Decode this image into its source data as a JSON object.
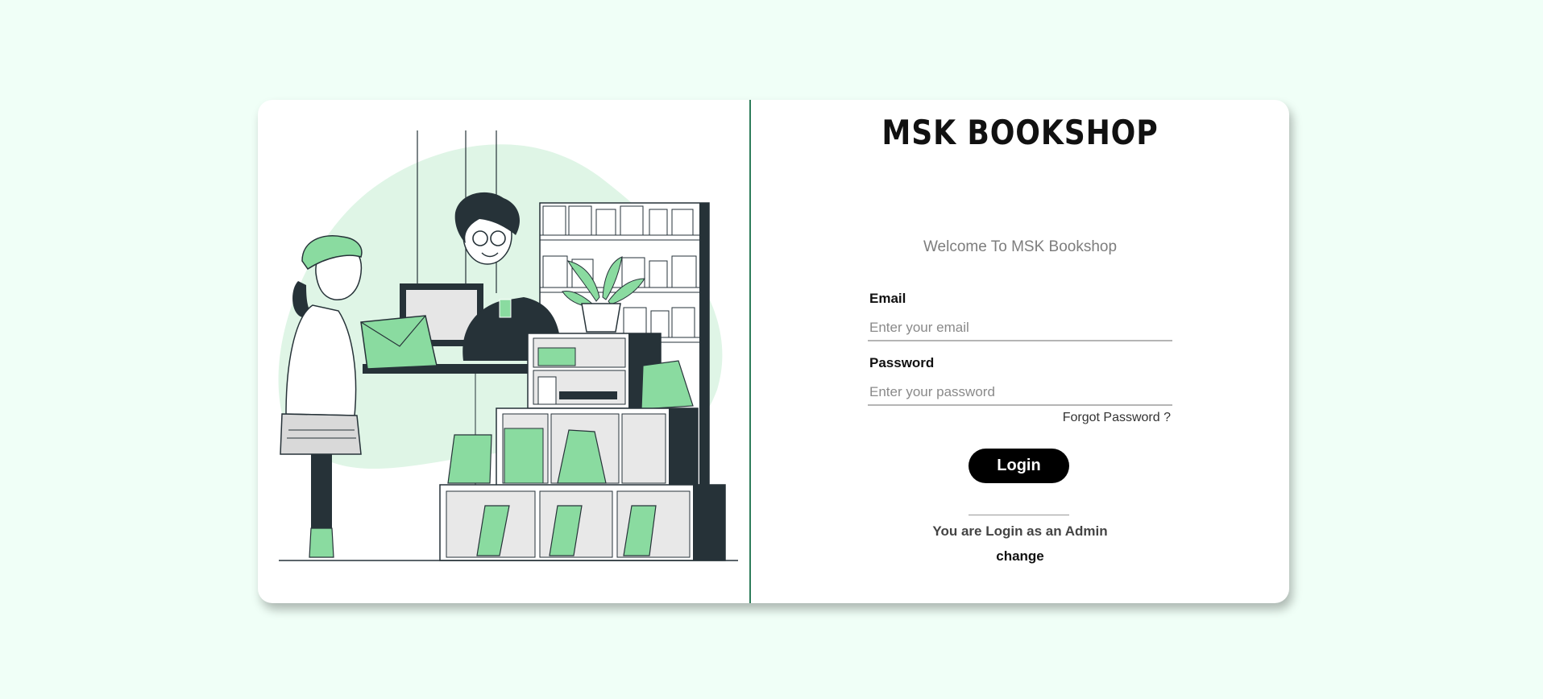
{
  "brand": {
    "title": "MSK BOOKSHOP"
  },
  "login": {
    "welcome": "Welcome To MSK Bookshop",
    "email_label": "Email",
    "email_placeholder": "Enter your email",
    "email_value": "",
    "password_label": "Password",
    "password_placeholder": "Enter your password",
    "password_value": "",
    "forgot_label": "Forgot Password ?",
    "submit_label": "Login",
    "role_note": "You are Login as an Admin",
    "change_label": "change"
  },
  "colors": {
    "page_background": "#f0fff7",
    "accent_green": "#8adba0",
    "dark": "#263238",
    "divider": "#2e7d5b",
    "button": "#000000"
  },
  "illustration": {
    "name": "bookshop-scene-illustration"
  }
}
